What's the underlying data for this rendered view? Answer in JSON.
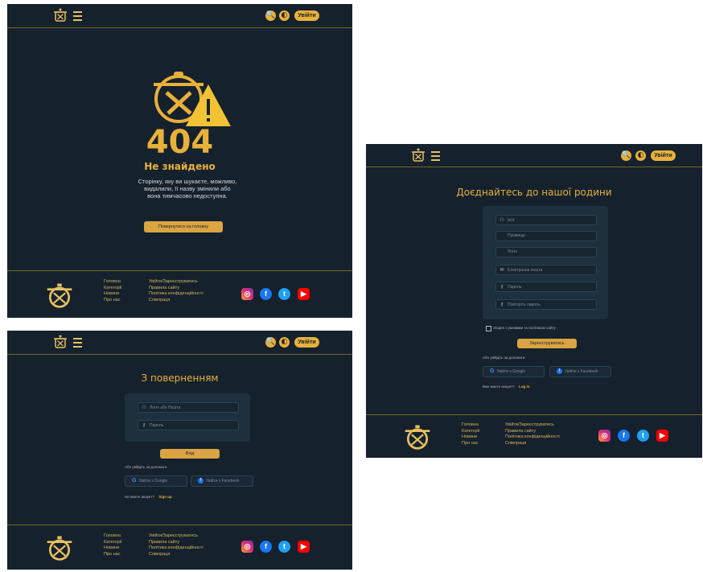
{
  "header": {
    "login_label": "Увійти",
    "search_icon": "🔍",
    "theme_icon": "◐"
  },
  "footer": {
    "col1": [
      "Головна",
      "Категорії",
      "Новини",
      "Про нас"
    ],
    "col2": [
      "Увійти/Зареєструватись",
      "Правила сайту",
      "Політика конфіденційності",
      "Співпраця"
    ],
    "socials": [
      "instagram",
      "facebook",
      "twitter",
      "youtube"
    ]
  },
  "not_found": {
    "code": "404",
    "title": "Не знайдено",
    "message": "Сторінку, яку ви шукаєте, можливо, видалили, її назву змінили або вона тимчасово недоступна.",
    "button": "Повернутися на головну"
  },
  "login": {
    "title": "З поверненням",
    "login_placeholder": "Логін або Пошта",
    "password_placeholder": "Пароль",
    "submit": "Вхід",
    "alt_text": "Або увійдіть за допомоги",
    "google": "Увійти з Google",
    "facebook": "Увійти з Facebook",
    "no_account": "Не маєте акаунт?",
    "signup_link": "Sign up"
  },
  "register": {
    "title": "Доєднайтесь до нашої родини",
    "name_placeholder": "Ім'я",
    "surname_placeholder": "Прізвище",
    "login_placeholder": "Логін",
    "email_placeholder": "Електронна пошта",
    "password_placeholder": "Пароль",
    "repeat_placeholder": "Повторіть пароль",
    "agree": "Згоден з умовами та політикою сайту",
    "submit": "Зареєструватись",
    "alt_text": "Або увійдіть за допомоги",
    "google": "Увійти з Google",
    "facebook": "Увійти з Facebook",
    "have_account": "Вже маєте акаунт?",
    "login_link": "Log in"
  }
}
